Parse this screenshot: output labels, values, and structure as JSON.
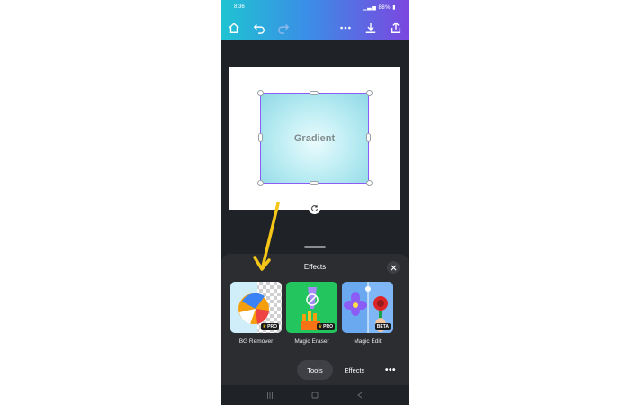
{
  "status_bar": {
    "time": "8:36",
    "battery": "88%"
  },
  "toolbar": {
    "icons": [
      "home-icon",
      "undo-icon",
      "redo-icon",
      "more-icon",
      "download-icon",
      "share-icon"
    ]
  },
  "canvas": {
    "element_text": "Gradient"
  },
  "panel": {
    "title": "Effects",
    "tools": [
      {
        "label": "BG Remover",
        "badge": "PRO"
      },
      {
        "label": "Magic Eraser",
        "badge": "PRO"
      },
      {
        "label": "Magic Edit",
        "badge": "BETA"
      }
    ],
    "tabs": [
      {
        "label": "Tools",
        "active": true
      },
      {
        "label": "Effects",
        "active": false
      }
    ],
    "more": "•••"
  },
  "colors": {
    "brand_start": "#1fc3d2",
    "brand_end": "#7b47e0",
    "selection": "#8b5cf6",
    "annotation_arrow": "#f5c518"
  }
}
